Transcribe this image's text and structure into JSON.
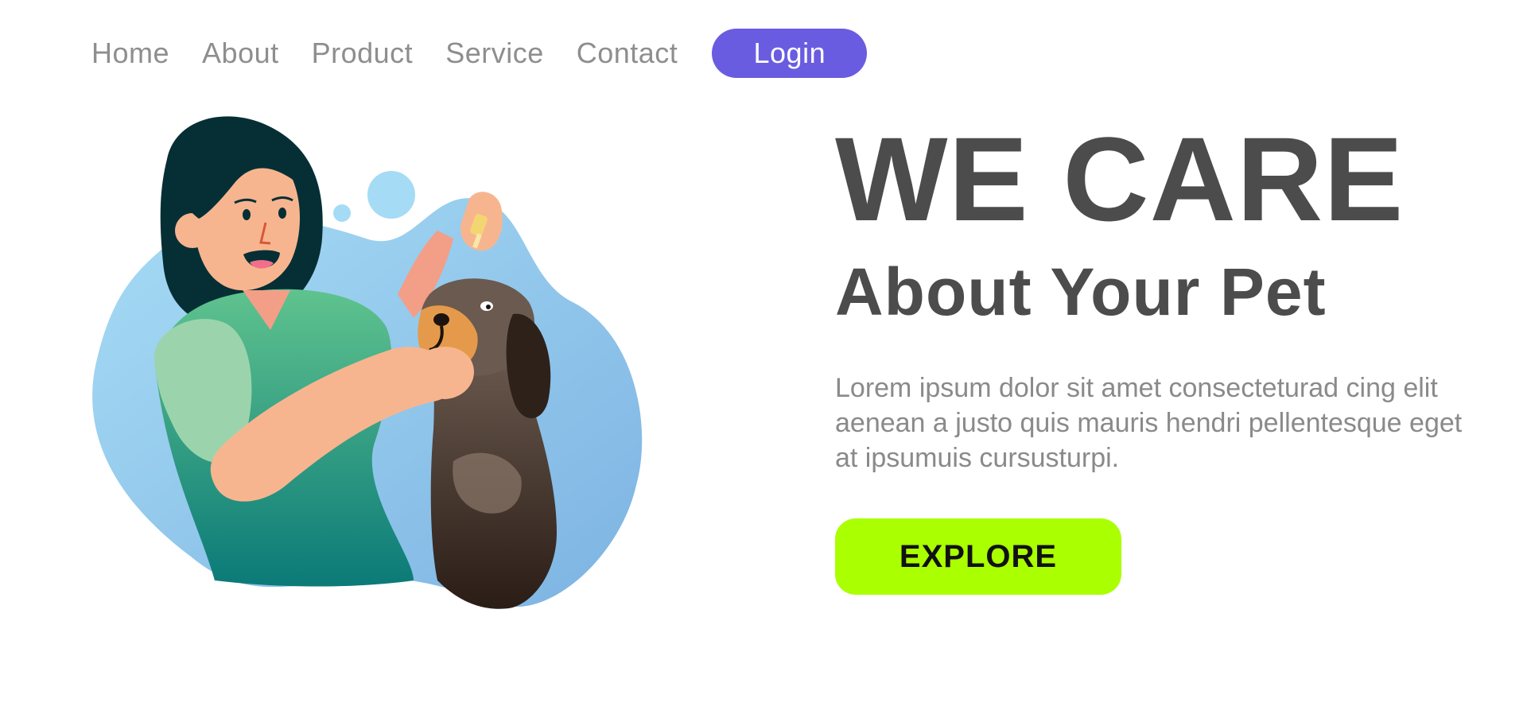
{
  "nav": {
    "links": [
      "Home",
      "About",
      "Product",
      "Service",
      "Contact"
    ],
    "login_label": "Login",
    "login_color": "#6a5ce0"
  },
  "hero": {
    "title": "WE CARE",
    "subtitle": "About Your Pet",
    "paragraph": "Lorem ipsum dolor sit amet consecteturad cing elit aenean a justo quis mauris hendri pellentesque eget at ipsumuis cursusturpi.",
    "explore_label": "EXPLORE",
    "explore_color": "#aaff00"
  },
  "illustration": {
    "subject": "woman-giving-ear-drops-to-dog",
    "colors": {
      "blob": "#8ec9ee",
      "scrubs": "#2e9e7e",
      "skin": "#f7b58f",
      "hair": "#052f35",
      "dog": "#4a3a30"
    }
  }
}
